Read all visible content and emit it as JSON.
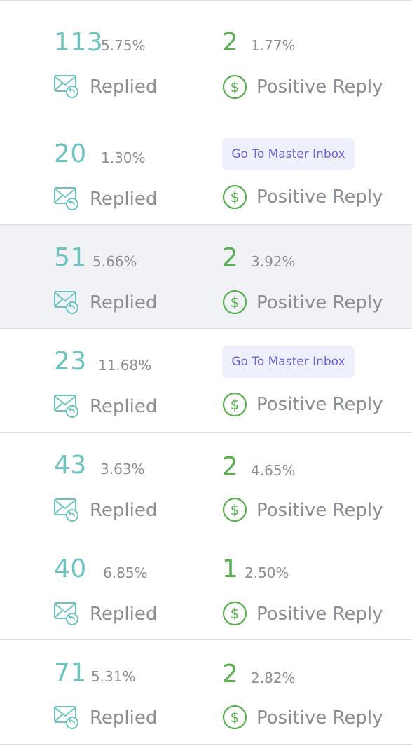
{
  "rows": [
    {
      "replied_count": "113",
      "replied_pct": "5.75%",
      "replied_label": "Replied",
      "positive_count": "2",
      "positive_pct": "1.77%",
      "positive_label": "Positive Reply",
      "highlight": false
    },
    {
      "replied_count": "20",
      "replied_pct": "1.30%",
      "replied_label": "Replied",
      "inbox_button": "Go To Master Inbox",
      "positive_label": "Positive Reply",
      "highlight": false
    },
    {
      "replied_count": "51",
      "replied_pct": "5.66%",
      "replied_label": "Replied",
      "positive_count": "2",
      "positive_pct": "3.92%",
      "positive_label": "Positive Reply",
      "highlight": true
    },
    {
      "replied_count": "23",
      "replied_pct": "11.68%",
      "replied_label": "Replied",
      "inbox_button": "Go To Master Inbox",
      "positive_label": "Positive Reply",
      "highlight": false
    },
    {
      "replied_count": "43",
      "replied_pct": "3.63%",
      "replied_label": "Replied",
      "positive_count": "2",
      "positive_pct": "4.65%",
      "positive_label": "Positive Reply",
      "highlight": false
    },
    {
      "replied_count": "40",
      "replied_pct": "6.85%",
      "replied_label": "Replied",
      "positive_count": "1",
      "positive_pct": "2.50%",
      "positive_label": "Positive Reply",
      "highlight": false
    },
    {
      "replied_count": "71",
      "replied_pct": "5.31%",
      "replied_label": "Replied",
      "positive_count": "2",
      "positive_pct": "2.82%",
      "positive_label": "Positive Reply",
      "highlight": false
    }
  ],
  "colors": {
    "teal": "#6cc3c0",
    "green": "#58b04f",
    "muted_text": "#8b8f96",
    "button_text": "#6b63d8",
    "button_bg": "#eef0fb",
    "highlight_bg": "#f1f2f6",
    "divider": "#dcdde2"
  },
  "icons": {
    "replied": "mail-reply-icon",
    "positive": "dollar-circle-icon"
  }
}
